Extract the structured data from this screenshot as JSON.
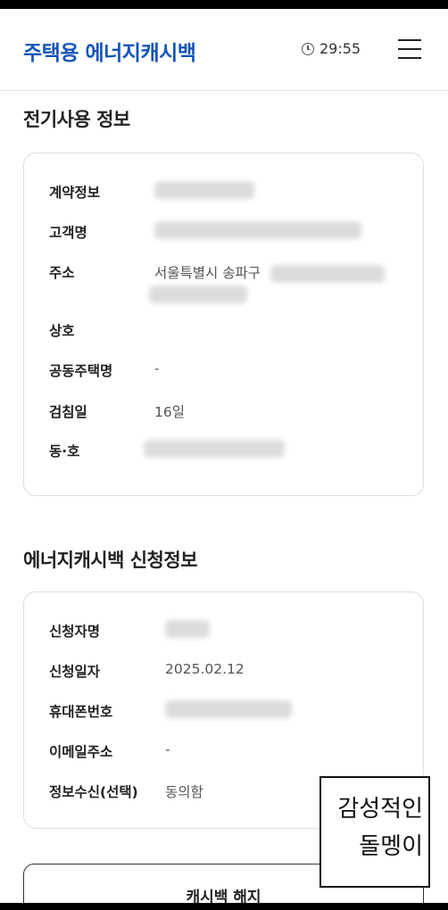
{
  "header": {
    "logo": "주택용 에너지캐시백",
    "timer": "29:55",
    "timer_icon": "clock-icon",
    "menu_icon": "hamburger-menu-icon"
  },
  "electricity": {
    "title": "전기사용 정보",
    "fields": {
      "contract": {
        "label": "계약정보"
      },
      "customer": {
        "label": "고객명"
      },
      "address": {
        "label": "주소",
        "value": "서울특별시 송파구"
      },
      "business": {
        "label": "상호",
        "value": ""
      },
      "apartment": {
        "label": "공동주택명",
        "value": "-"
      },
      "reading_day": {
        "label": "검침일",
        "value": "16일"
      },
      "unit": {
        "label": "동·호"
      }
    }
  },
  "application": {
    "title": "에너지캐시백 신청정보",
    "fields": {
      "applicant": {
        "label": "신청자명"
      },
      "date": {
        "label": "신청일자",
        "value": "2025.02.12"
      },
      "phone": {
        "label": "휴대폰번호"
      },
      "email": {
        "label": "이메일주소",
        "value": "-"
      },
      "consent": {
        "label": "정보수신(선택)",
        "value": "동의함"
      }
    }
  },
  "cancel_button": "캐시백 해지",
  "watermark": {
    "line1": "감성적인",
    "line2": "돌멩이"
  }
}
